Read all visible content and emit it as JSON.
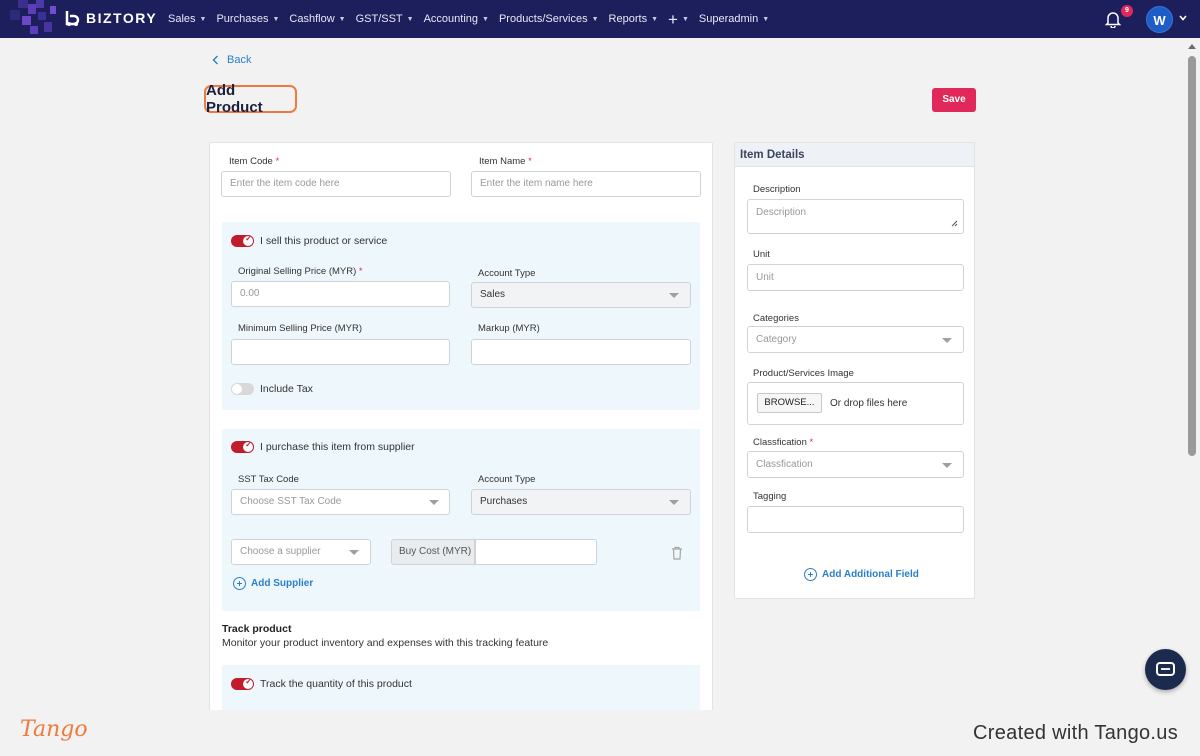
{
  "nav": {
    "brand": "BIZTORY",
    "items": [
      "Sales",
      "Purchases",
      "Cashflow",
      "GST/SST",
      "Accounting",
      "Products/Services",
      "Reports"
    ],
    "plus": "+",
    "last_item": "Superadmin",
    "notification_count": "9",
    "avatar_initial": "W"
  },
  "page": {
    "back": "Back",
    "title": "Add Product",
    "save": "Save"
  },
  "form": {
    "item_code_label": "Item Code",
    "item_code_placeholder": "Enter the item code here",
    "item_name_label": "Item Name",
    "item_name_placeholder": "Enter the item name here",
    "sell_toggle": "I sell this product or service",
    "original_price_label": "Original Selling Price (MYR)",
    "original_price_placeholder": "0.00",
    "sell_account_type_label": "Account Type",
    "sell_account_type_value": "Sales",
    "min_price_label": "Minimum Selling Price (MYR)",
    "markup_label": "Markup (MYR)",
    "include_tax": "Include Tax",
    "purchase_toggle": "I purchase this item from supplier",
    "sst_label": "SST Tax Code",
    "sst_placeholder": "Choose SST Tax Code",
    "purchase_account_type_label": "Account Type",
    "purchase_account_type_value": "Purchases",
    "supplier_placeholder": "Choose a supplier",
    "buy_cost_label": "Buy Cost (MYR)",
    "add_supplier": "Add Supplier",
    "track_title": "Track product",
    "track_subtitle": "Monitor your product inventory and expenses with this tracking feature",
    "track_toggle": "Track the quantity of this product",
    "required_mark": "*"
  },
  "details": {
    "heading": "Item Details",
    "description_label": "Description",
    "description_placeholder": "Description",
    "unit_label": "Unit",
    "unit_placeholder": "Unit",
    "categories_label": "Categories",
    "categories_placeholder": "Category",
    "image_label": "Product/Services Image",
    "browse": "BROWSE...",
    "drop": "Or drop files here",
    "classification_label": "Classfication",
    "classification_placeholder": "Classfication",
    "tagging_label": "Tagging",
    "add_field": "Add Additional Field"
  },
  "footer": {
    "tango": "Tango",
    "created": "Created with Tango.us"
  },
  "colors": {
    "nav_bg": "#1c1f5c",
    "accent": "#e0285a",
    "link": "#2b7fc9",
    "toggle_on": "#c21b2c",
    "highlight": "#f07a3c"
  }
}
